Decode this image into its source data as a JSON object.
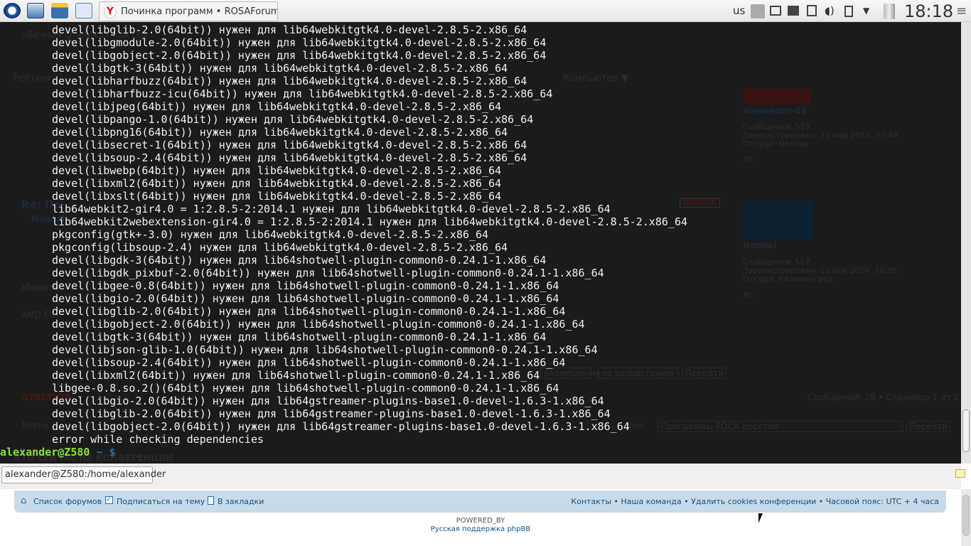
{
  "taskbar": {
    "window_title": "Починка программ • ROSAForum —",
    "keyboard_layout": "us",
    "clock": "18:18",
    "icons": [
      "rosa-menu-icon",
      "desktop-icon",
      "file-manager-icon",
      "text-editor-icon"
    ],
    "tray_icons": [
      "antivirus-icon",
      "window-icon",
      "window-icon-2",
      "network-icon",
      "volume-icon",
      "clipboard-icon",
      "tray-expand-icon",
      "trash-icon"
    ]
  },
  "background_browser": {
    "tab_text": "«Вечная флешка» как cos",
    "nav_rating": "Рейтинг",
    "nav_computer": "Компьютер ▼",
    "post_title": "Re: По",
    "post_author": "Nemial",
    "post_text": "Можете",
    "signature": "AMD FX",
    "reply_button": "ОТВЕТИТЬ",
    "back_link": "‹ Верну",
    "quote_button": "ЦИТАТА",
    "who_online": "КТО СЕЙЧАС НА КОНФЕРЕНЦИИ",
    "users": [
      {
        "name": "alexander-d3",
        "posts_label": "Сообщения:",
        "posts": "523",
        "reg_label": "Зарегистрирован:",
        "reg": "31 мар 2014, 22:48",
        "from_label": "Откуда:",
        "from": "Москва",
        "pm": "ЛС"
      },
      {
        "name": "Nemial",
        "posts_label": "Сообщения:",
        "posts": "567",
        "reg_label": "Зарегистрирован:",
        "reg": "13 дек 2014, 18:06",
        "from_label": "Откуда:",
        "from": "Калининград",
        "pm": "ЛС"
      }
    ],
    "sort_by": "размещения",
    "sort_order": "по возрастанию",
    "go_button": "Перейти",
    "pagination": "Сообщений: 28 • Страница 1 из 1",
    "jump_label": "йти:",
    "jump_select": "Программы РОСА десктоп",
    "go_button2": "Перейти"
  },
  "terminal": {
    "lines": [
      "devel(libglib-2.0(64bit)) нужен для lib64webkitgtk4.0-devel-2.8.5-2.x86_64",
      "devel(libgmodule-2.0(64bit)) нужен для lib64webkitgtk4.0-devel-2.8.5-2.x86_64",
      "devel(libgobject-2.0(64bit)) нужен для lib64webkitgtk4.0-devel-2.8.5-2.x86_64",
      "devel(libgtk-3(64bit)) нужен для lib64webkitgtk4.0-devel-2.8.5-2.x86_64",
      "devel(libharfbuzz(64bit)) нужен для lib64webkitgtk4.0-devel-2.8.5-2.x86_64",
      "devel(libharfbuzz-icu(64bit)) нужен для lib64webkitgtk4.0-devel-2.8.5-2.x86_64",
      "devel(libjpeg(64bit)) нужен для lib64webkitgtk4.0-devel-2.8.5-2.x86_64",
      "devel(libpango-1.0(64bit)) нужен для lib64webkitgtk4.0-devel-2.8.5-2.x86_64",
      "devel(libpng16(64bit)) нужен для lib64webkitgtk4.0-devel-2.8.5-2.x86_64",
      "devel(libsecret-1(64bit)) нужен для lib64webkitgtk4.0-devel-2.8.5-2.x86_64",
      "devel(libsoup-2.4(64bit)) нужен для lib64webkitgtk4.0-devel-2.8.5-2.x86_64",
      "devel(libwebp(64bit)) нужен для lib64webkitgtk4.0-devel-2.8.5-2.x86_64",
      "devel(libxml2(64bit)) нужен для lib64webkitgtk4.0-devel-2.8.5-2.x86_64",
      "devel(libxslt(64bit)) нужен для lib64webkitgtk4.0-devel-2.8.5-2.x86_64",
      "lib64webkit2-gir4.0 = 1:2.8.5-2:2014.1 нужен для lib64webkitgtk4.0-devel-2.8.5-2.x86_64",
      "lib64webkit2webextension-gir4.0 = 1:2.8.5-2:2014.1 нужен для lib64webkitgtk4.0-devel-2.8.5-2.x86_64",
      "pkgconfig(gtk+-3.0) нужен для lib64webkitgtk4.0-devel-2.8.5-2.x86_64",
      "pkgconfig(libsoup-2.4) нужен для lib64webkitgtk4.0-devel-2.8.5-2.x86_64",
      "devel(libgdk-3(64bit)) нужен для lib64shotwell-plugin-common0-0.24.1-1.x86_64",
      "devel(libgdk_pixbuf-2.0(64bit)) нужен для lib64shotwell-plugin-common0-0.24.1-1.x86_64",
      "devel(libgee-0.8(64bit)) нужен для lib64shotwell-plugin-common0-0.24.1-1.x86_64",
      "devel(libgio-2.0(64bit)) нужен для lib64shotwell-plugin-common0-0.24.1-1.x86_64",
      "devel(libglib-2.0(64bit)) нужен для lib64shotwell-plugin-common0-0.24.1-1.x86_64",
      "devel(libgobject-2.0(64bit)) нужен для lib64shotwell-plugin-common0-0.24.1-1.x86_64",
      "devel(libgtk-3(64bit)) нужен для lib64shotwell-plugin-common0-0.24.1-1.x86_64",
      "devel(libjson-glib-1.0(64bit)) нужен для lib64shotwell-plugin-common0-0.24.1-1.x86_64",
      "devel(libsoup-2.4(64bit)) нужен для lib64shotwell-plugin-common0-0.24.1-1.x86_64",
      "devel(libxml2(64bit)) нужен для lib64shotwell-plugin-common0-0.24.1-1.x86_64",
      "libgee-0.8.so.2()(64bit) нужен для lib64shotwell-plugin-common0-0.24.1-1.x86_64",
      "devel(libgio-2.0(64bit)) нужен для lib64gstreamer-plugins-base1.0-devel-1.6.3-1.x86_64",
      "devel(libglib-2.0(64bit)) нужен для lib64gstreamer-plugins-base1.0-devel-1.6.3-1.x86_64",
      "devel(libgobject-2.0(64bit)) нужен для lib64gstreamer-plugins-base1.0-devel-1.6.3-1.x86_64",
      "error while checking dependencies"
    ],
    "prompt_user": "alexander@Z580",
    "prompt_path": " ~ $",
    "tab_title": "alexander@Z580:/home/alexander"
  },
  "footer": {
    "forum_list": "Список форумов",
    "subscribe": "Подписаться на тему",
    "bookmark": "В закладки",
    "right_links": "Контакты • Наша команда • Удалить cookies конференции • Часовой пояс: UTC + 4 часа",
    "powered_by": "POWERED_BY",
    "support": "Русская поддержка phpBB"
  }
}
